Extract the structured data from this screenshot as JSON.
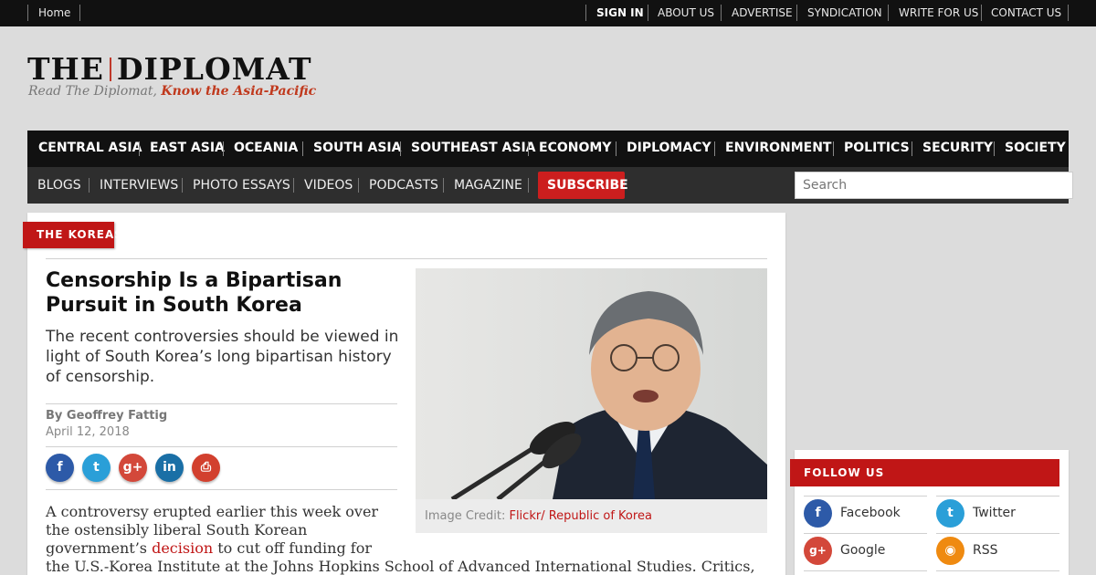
{
  "topbar": {
    "home": "Home",
    "sign_in": "SIGN IN",
    "about": "ABOUT US",
    "advertise": "ADVERTISE",
    "syndication": "SYNDICATION",
    "write": "WRITE FOR US",
    "contact": "CONTACT US"
  },
  "logo": {
    "part1": "THE",
    "part2": "DIPLOMAT",
    "tagline_plain": "Read The Diplomat, ",
    "tagline_emphasis": "Know the Asia-Pacific"
  },
  "main_nav": [
    "CENTRAL ASIA",
    "EAST ASIA",
    "OCEANIA",
    "SOUTH ASIA",
    "SOUTHEAST ASIA",
    "ECONOMY",
    "DIPLOMACY",
    "ENVIRONMENT",
    "POLITICS",
    "SECURITY",
    "SOCIETY"
  ],
  "sub_nav": [
    "BLOGS",
    "INTERVIEWS",
    "PHOTO ESSAYS",
    "VIDEOS",
    "PODCASTS",
    "MAGAZINE"
  ],
  "subscribe_label": "SUBSCRIBE",
  "search_placeholder": "Search",
  "article": {
    "section": "THE KOREAS",
    "title": "Censorship Is a Bipartisan Pursuit in South Korea",
    "dek": "The recent controversies should be viewed in light of South Korea’s long bipartisan history of censorship.",
    "byline": "By Geoffrey Fattig",
    "date": "April 12, 2018",
    "body_line1": "A controversy erupted earlier this week over",
    "body_line2": "the ostensibly liberal South Korean",
    "body_line3_a": "government’s ",
    "body_line3_link": "decision",
    "body_line3_b": " to cut off funding for",
    "body_line4": "the U.S.-Korea Institute at the Johns Hopkins School of Advanced International Studies. Critics,",
    "caption_label": "Image Credit: ",
    "caption_value": "Flickr/ Republic of Korea"
  },
  "share_icons": [
    {
      "icon": "facebook-icon",
      "glyph": "f",
      "color": "#2d5aa8"
    },
    {
      "icon": "twitter-icon",
      "glyph": "t",
      "color": "#2a9fd8"
    },
    {
      "icon": "google-plus-icon",
      "glyph": "g+",
      "color": "#d3483a"
    },
    {
      "icon": "linkedin-icon",
      "glyph": "in",
      "color": "#1a6fa6"
    },
    {
      "icon": "print-icon",
      "glyph": "⎙",
      "color": "#d2402e"
    }
  ],
  "follow": {
    "title": "FOLLOW US",
    "items": [
      {
        "label": "Facebook",
        "icon": "facebook-icon",
        "glyph": "f",
        "color": "#2d5aa8"
      },
      {
        "label": "Twitter",
        "icon": "twitter-icon",
        "glyph": "t",
        "color": "#2a9fd8"
      },
      {
        "label": "Google",
        "icon": "google-plus-icon",
        "glyph": "g+",
        "color": "#d3483a"
      },
      {
        "label": "RSS",
        "icon": "rss-icon",
        "glyph": "◉",
        "color": "#ef8a10"
      }
    ]
  }
}
